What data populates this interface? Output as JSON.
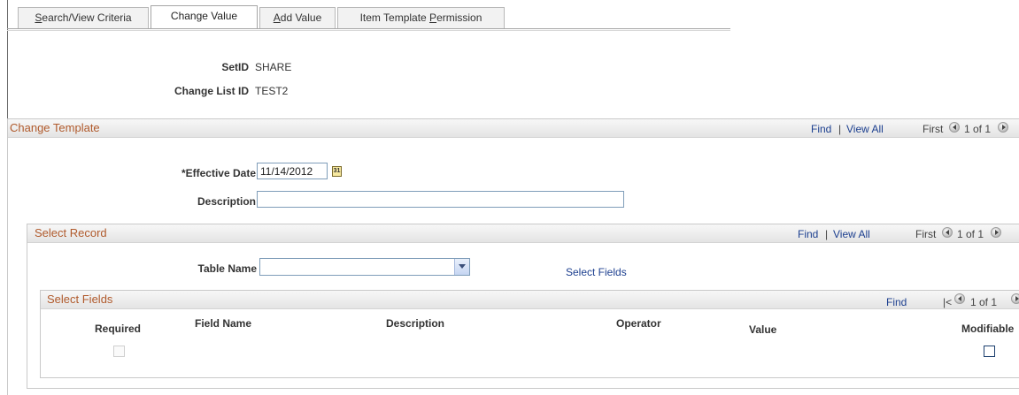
{
  "tabs": [
    {
      "pre": "",
      "ul": "S",
      "post": "earch/View Criteria"
    },
    {
      "pre": "Change Value",
      "ul": "",
      "post": ""
    },
    {
      "pre": "",
      "ul": "A",
      "post": "dd Value"
    },
    {
      "pre": "Item Template ",
      "ul": "P",
      "post": "ermission"
    }
  ],
  "header": {
    "setid_label": "SetID",
    "setid_value": "SHARE",
    "changelist_label": "Change List ID",
    "changelist_value": "TEST2"
  },
  "change_template": {
    "title": "Change Template",
    "find": "Find",
    "sep": "|",
    "view_all": "View All",
    "first": "First",
    "count": "1 of 1",
    "effective_date_label": "*Effective Date",
    "effective_date_value": "11/14/2012",
    "calendar_icon_text": "31",
    "description_label": "Description",
    "description_value": ""
  },
  "select_record": {
    "title": "Select Record",
    "find": "Find",
    "sep": "|",
    "view_all": "View All",
    "first": "First",
    "count": "1 of 1",
    "table_name_label": "Table Name",
    "table_name_value": "",
    "select_fields_link": "Select Fields"
  },
  "select_fields": {
    "title": "Select Fields",
    "find": "Find",
    "first": "|<",
    "count": "1 of 1",
    "columns": {
      "required": "Required",
      "field_name": "Field Name",
      "description": "Description",
      "operator": "Operator",
      "value": "Value",
      "modifiable": "Modifiable"
    }
  },
  "icons": {
    "calendar": "calendar-icon",
    "prev": "arrow-left-icon",
    "next": "arrow-right-icon",
    "dropdown": "chevron-down-icon"
  },
  "colors": {
    "group_title": "#b05a2c",
    "link": "#1c3f8f"
  }
}
